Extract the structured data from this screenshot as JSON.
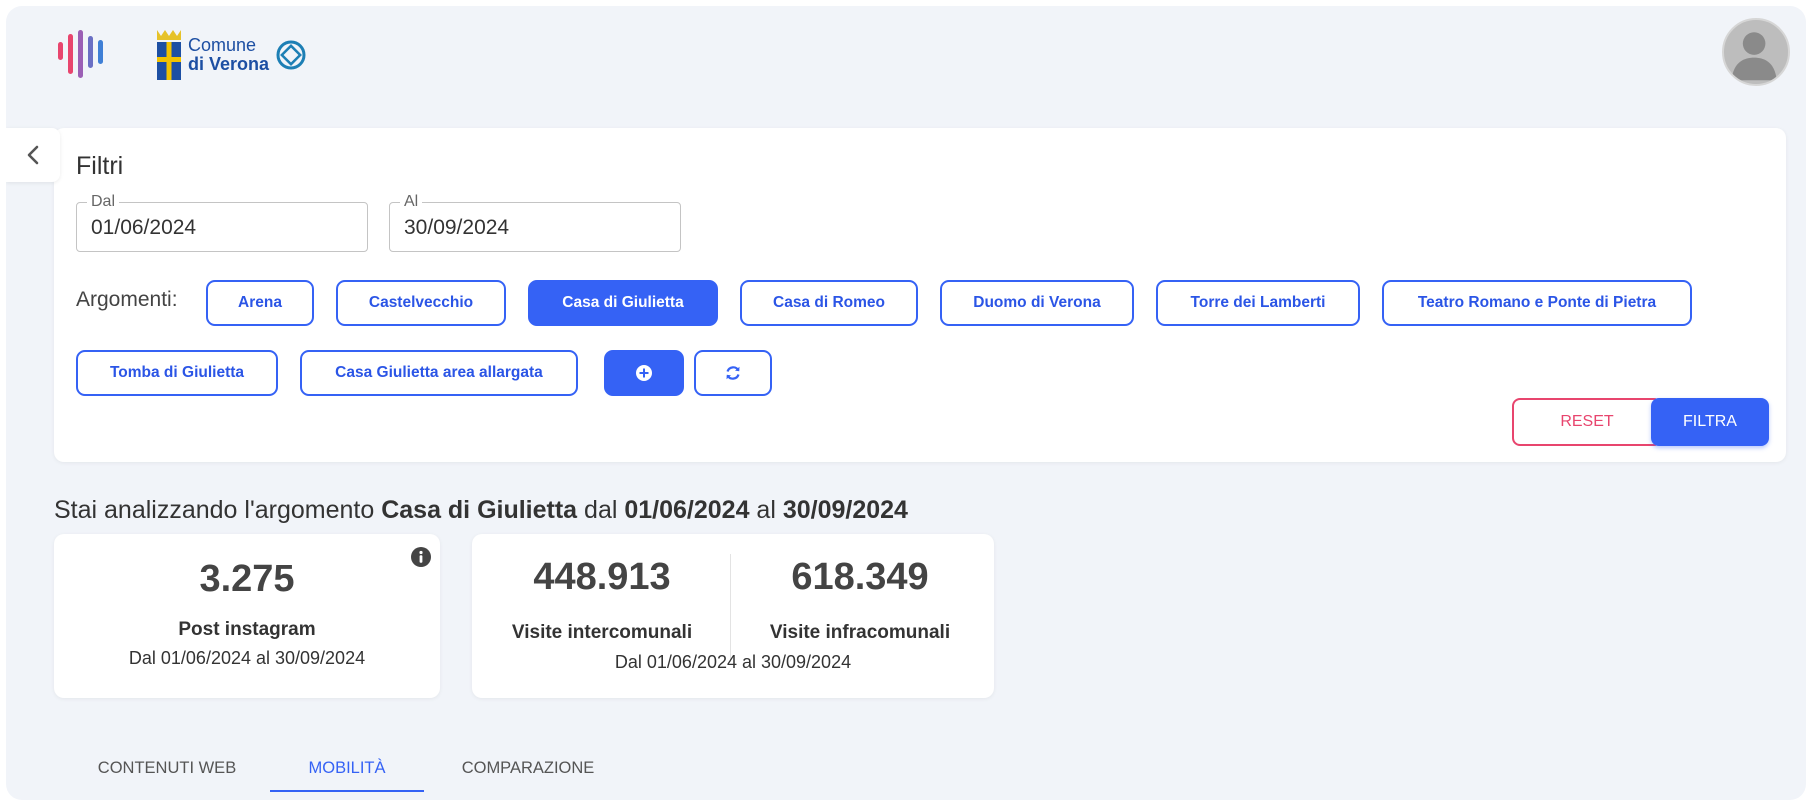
{
  "header": {
    "brand_line1": "Comune",
    "brand_line2": "di Verona"
  },
  "filters": {
    "title": "Filtri",
    "from": {
      "label": "Dal",
      "value": "01/06/2024"
    },
    "to": {
      "label": "Al",
      "value": "30/09/2024"
    },
    "topics_label": "Argomenti:",
    "topics": [
      {
        "label": "Arena",
        "selected": false
      },
      {
        "label": "Castelvecchio",
        "selected": false
      },
      {
        "label": "Casa di Giulietta",
        "selected": true
      },
      {
        "label": "Casa di Romeo",
        "selected": false
      },
      {
        "label": "Duomo di Verona",
        "selected": false
      },
      {
        "label": "Torre dei Lamberti",
        "selected": false
      },
      {
        "label": "Teatro Romano e Ponte di Pietra",
        "selected": false
      },
      {
        "label": "Tomba di Giulietta",
        "selected": false
      },
      {
        "label": "Casa Giulietta area allargata",
        "selected": false
      }
    ],
    "reset_label": "RESET",
    "filter_label": "FILTRA"
  },
  "summary": {
    "prefix": "Stai analizzando l'argomento ",
    "topic": "Casa di Giulietta",
    "mid1": " dal ",
    "from": "01/06/2024",
    "mid2": " al ",
    "to": "30/09/2024"
  },
  "metrics": {
    "instagram": {
      "value": "3.275",
      "label": "Post instagram",
      "range": "Dal 01/06/2024 al 30/09/2024"
    },
    "visits": {
      "inter_value": "448.913",
      "inter_label": "Visite intercomunali",
      "infra_value": "618.349",
      "infra_label": "Visite infracomunali",
      "range": "Dal 01/06/2024 al 30/09/2024"
    }
  },
  "tabs": [
    {
      "label": "CONTENUTI WEB",
      "active": false
    },
    {
      "label": "MOBILITÀ",
      "active": true
    },
    {
      "label": "COMPARAZIONE",
      "active": false
    }
  ],
  "colors": {
    "primary": "#3562f5",
    "reset": "#e8456e",
    "background": "#f1f4f9"
  }
}
